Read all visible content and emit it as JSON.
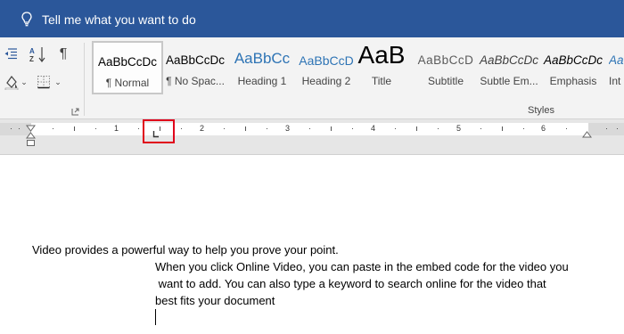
{
  "tellme": {
    "text": "Tell me what you want to do",
    "icon": "lightbulb-icon"
  },
  "styles": {
    "group_label": "Styles",
    "items": [
      {
        "sample": "AaBbCcDc",
        "name": "¶ Normal"
      },
      {
        "sample": "AaBbCcDc",
        "name": "¶ No Spac..."
      },
      {
        "sample": "AaBbCc",
        "name": "Heading 1"
      },
      {
        "sample": "AaBbCcD",
        "name": "Heading 2"
      },
      {
        "sample": "AaB",
        "name": "Title"
      },
      {
        "sample": "AaBbCcD",
        "name": "Subtitle"
      },
      {
        "sample": "AaBbCcDc",
        "name": "Subtle Em..."
      },
      {
        "sample": "AaBbCcDc",
        "name": "Emphasis"
      },
      {
        "sample": "AaBbCcDc",
        "name": "Int"
      }
    ]
  },
  "ruler": {
    "numbers": [
      "1",
      "2",
      "3",
      "4",
      "5",
      "6"
    ]
  },
  "document": {
    "lines": [
      "Video provides a powerful way to help you prove your point.",
      "When you click Online Video, you can paste in the embed code for the video you",
      " want to add. You can also type a keyword to search online for the video that",
      "best fits your document"
    ]
  },
  "colors": {
    "title_bar": "#2b579a",
    "highlight": "#e0001b",
    "heading_blue": "#2e74b5"
  }
}
